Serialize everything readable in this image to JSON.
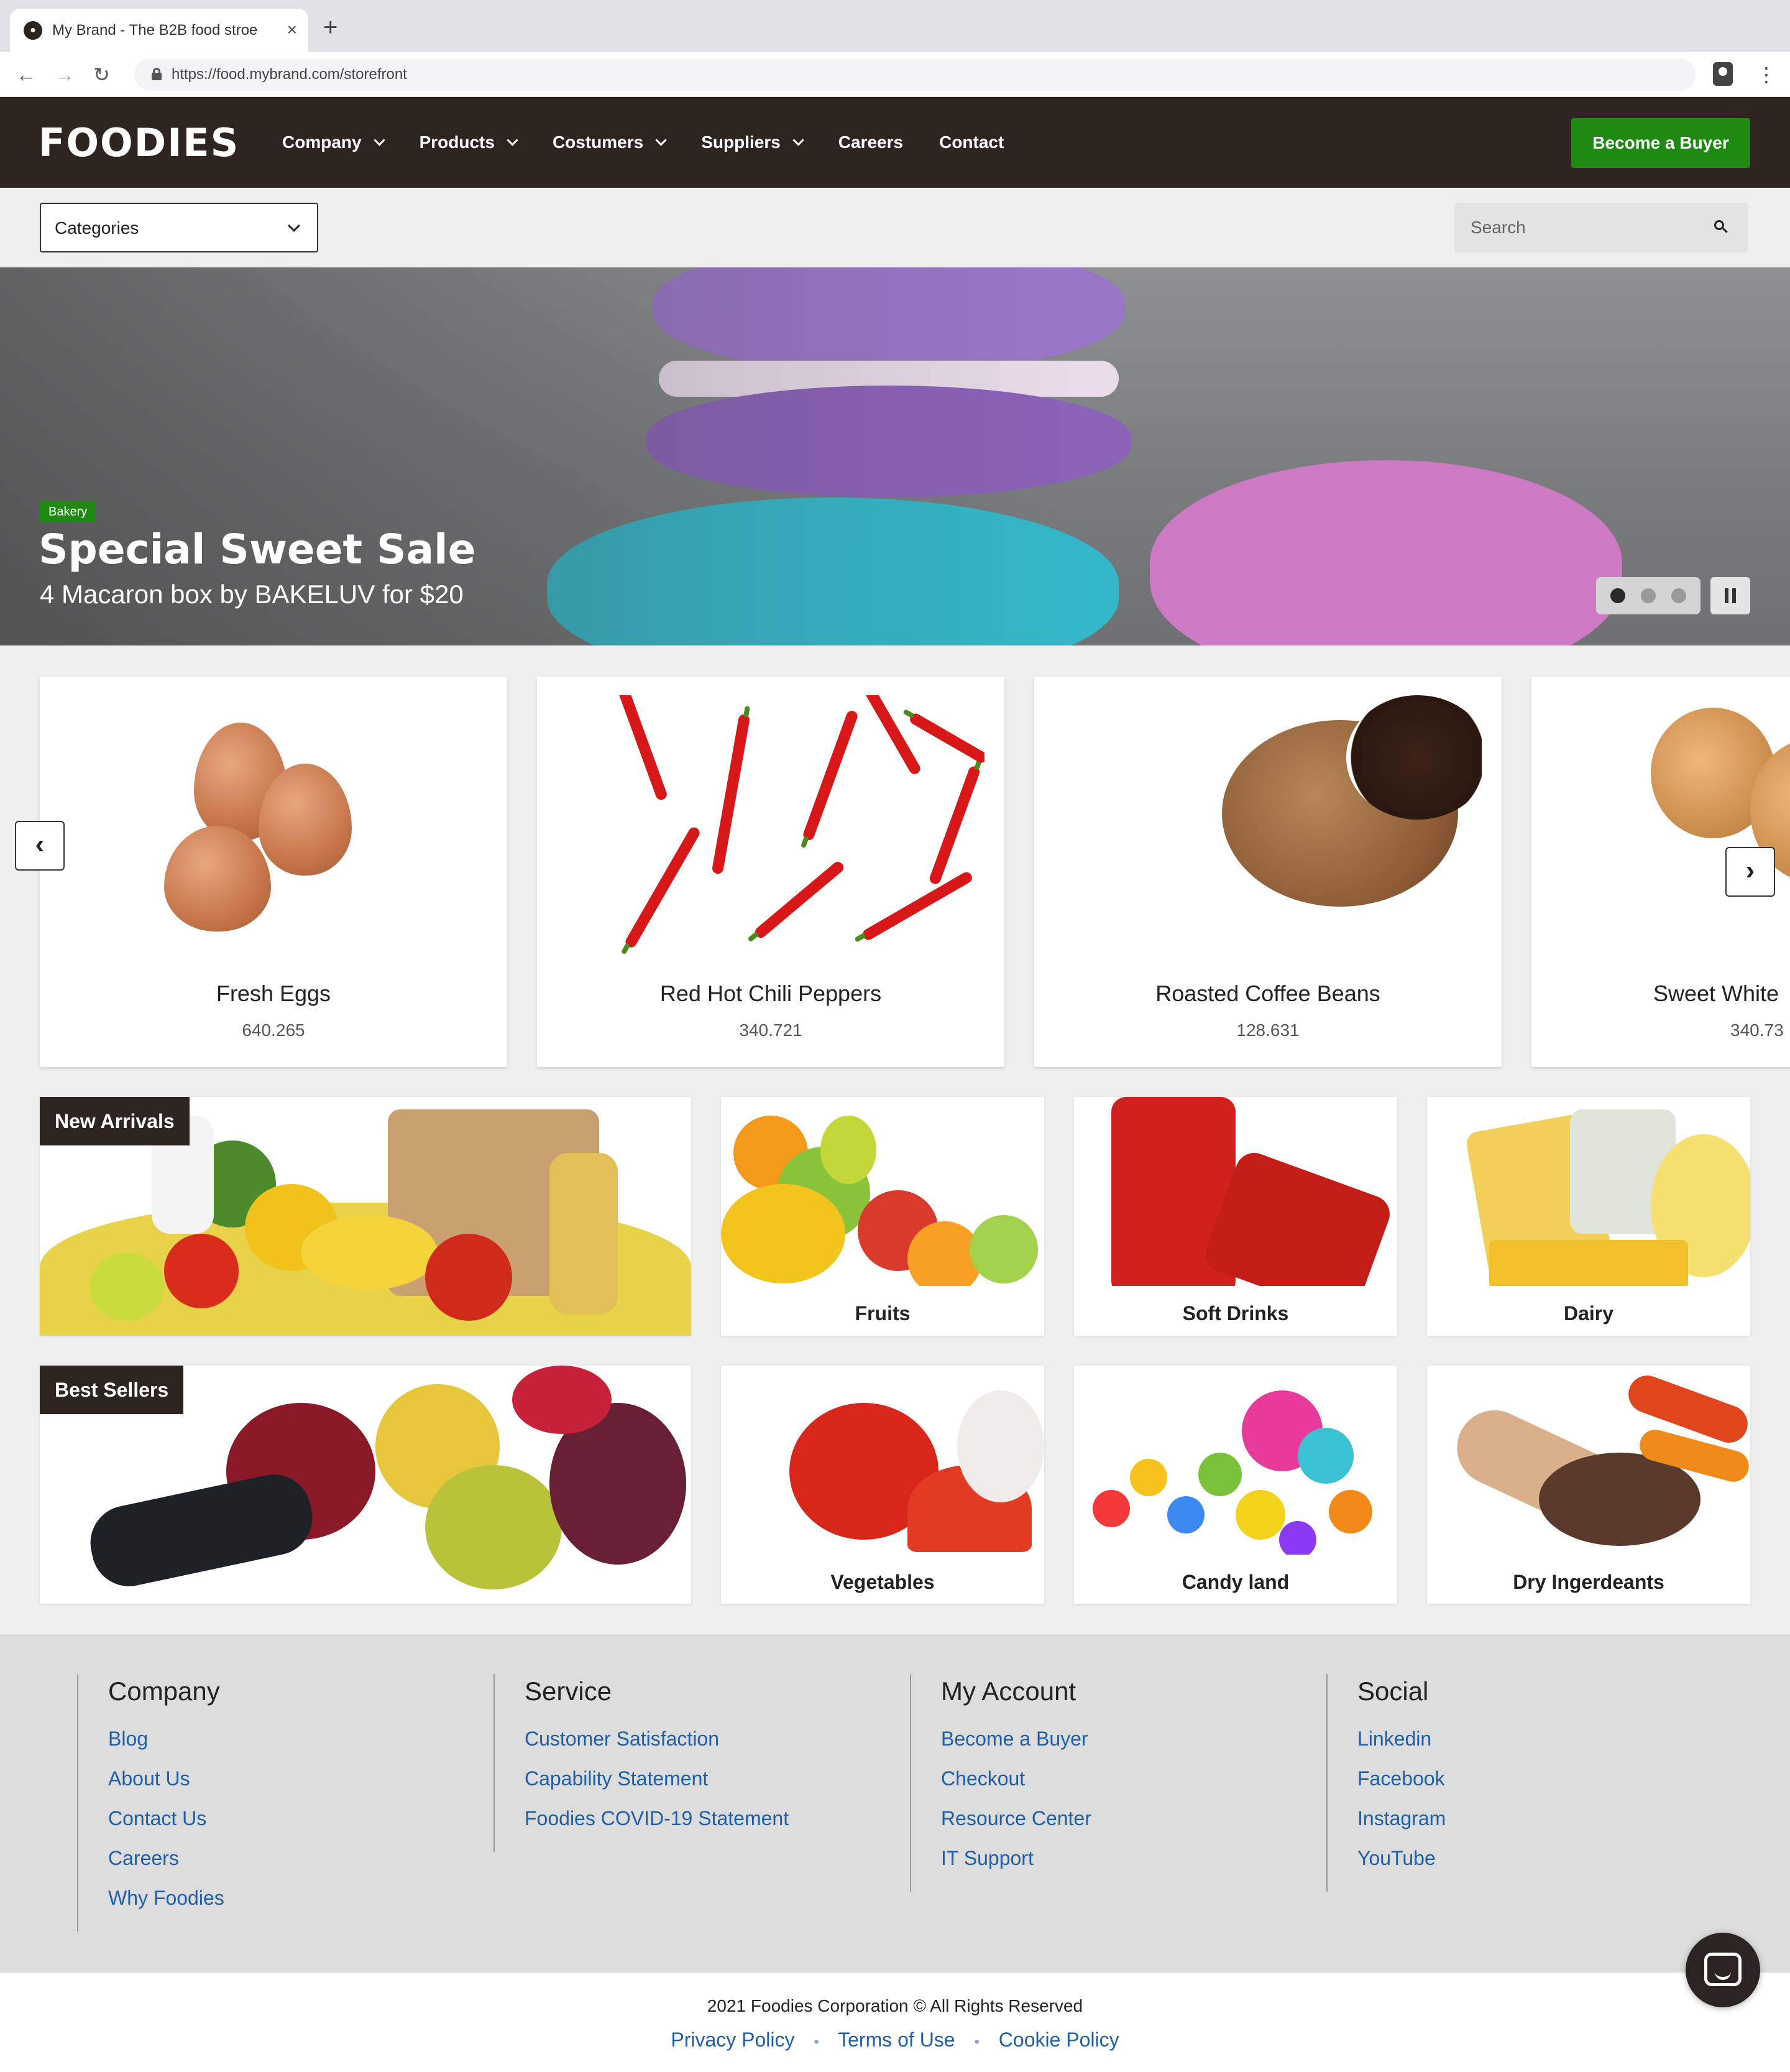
{
  "browser": {
    "tab_title": "My Brand - The B2B food stroe",
    "url": "https://food.mybrand.com/storefront",
    "new_tab": "+",
    "close_tab": "×"
  },
  "header": {
    "logo": "FOODIES",
    "nav": [
      "Company",
      "Products",
      "Costumers",
      "Suppliers",
      "Careers",
      "Contact"
    ],
    "cta": "Become a Buyer"
  },
  "filters": {
    "categories_label": "Categories",
    "search_placeholder": "Search"
  },
  "hero": {
    "badge": "Bakery",
    "title": "Special Sweet Sale",
    "subtitle": "4 Macaron box by BAKELUV for $20",
    "slides": 3,
    "active_slide": 1
  },
  "products": [
    {
      "name": "Fresh Eggs",
      "count": "640.265"
    },
    {
      "name": "Red Hot Chili Peppers",
      "count": "340.721"
    },
    {
      "name": "Roasted Coffee Beans",
      "count": "128.631"
    },
    {
      "name": "Sweet White",
      "count": "340.73"
    }
  ],
  "tiles": {
    "new_arrivals": "New Arrivals",
    "best_sellers": "Best Sellers",
    "row1": [
      "Fruits",
      "Soft Drinks",
      "Dairy"
    ],
    "row2": [
      "Vegetables",
      "Candy land",
      "Dry Ingerdeants"
    ]
  },
  "footer": {
    "columns": [
      {
        "title": "Company",
        "links": [
          "Blog",
          "About Us",
          "Contact Us",
          "Careers",
          "Why Foodies"
        ]
      },
      {
        "title": "Service",
        "links": [
          "Customer Satisfaction",
          "Capability Statement",
          "Foodies COVID-19 Statement"
        ]
      },
      {
        "title": "My Account",
        "links": [
          "Become a Buyer",
          "Checkout",
          "Resource Center",
          "IT Support"
        ]
      },
      {
        "title": "Social",
        "links": [
          "Linkedin",
          "Facebook",
          "Instagram",
          "YouTube"
        ]
      }
    ],
    "copyright": "2021 Foodies Corporation © All Rights Reserved",
    "legal": [
      "Privacy Policy",
      "Terms of Use",
      "Cookie Policy"
    ]
  },
  "colors": {
    "header_bg": "#2f2520",
    "accent_green": "#1f8a12",
    "link_blue": "#1e5fa8"
  }
}
